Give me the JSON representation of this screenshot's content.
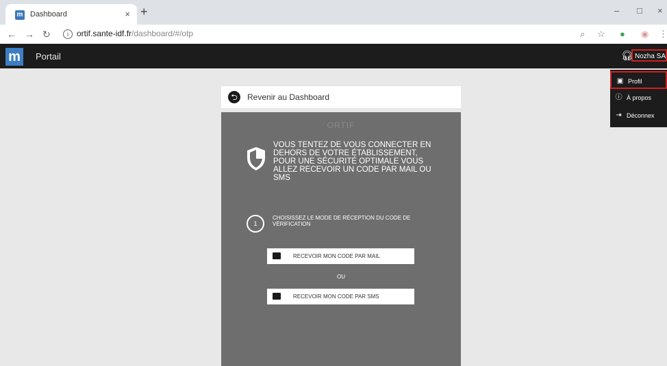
{
  "browser": {
    "tab_title": "Dashboard",
    "tab_close": "×",
    "new_tab": "+",
    "url_host": "ortif.sante-idf.fr",
    "url_path": "/dashboard/#/otp",
    "window_controls": [
      "–",
      "□",
      "×"
    ]
  },
  "app": {
    "name": "Portail",
    "user": "Nozha SALH"
  },
  "menu": {
    "items": [
      {
        "label": "Profil",
        "icon": "user-card-icon"
      },
      {
        "label": "À propos",
        "icon": "info-icon"
      },
      {
        "label": "Déconnex",
        "icon": "logout-icon"
      }
    ]
  },
  "page": {
    "back_label": "Revenir au Dashboard",
    "brand": "ORTIF",
    "warning": "VOUS TENTEZ DE VOUS CONNECTER EN DEHORS DE VOTRE ÉTABLISSEMENT, POUR UNE SÉCURITÉ OPTIMALE VOUS ALLEZ RECEVOIR UN CODE PAR MAIL OU SMS",
    "step_number": "1",
    "step_text": "CHOISISSEZ LE MODE DE RÉCEPTION DU CODE DE VÉRIFICATION",
    "mail_button": "RECEVOIR MON CODE PAR MAIL",
    "or_label": "OU",
    "sms_button": "RECEVOIR MON CODE PAR SMS"
  },
  "colors": {
    "header_bg": "#1c1c1c",
    "panel_bg": "#6e6e6e",
    "highlight": "#d12020",
    "logo": "#3d7ec4"
  }
}
